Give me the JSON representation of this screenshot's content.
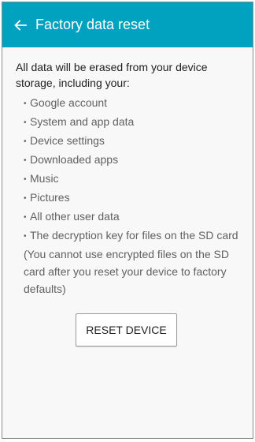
{
  "colors": {
    "app_bar": "#00a2c0",
    "background": "#f8f8f8"
  },
  "app_bar": {
    "back_icon": "arrow-left-icon",
    "title": "Factory data reset"
  },
  "content": {
    "intro": "All data will be erased from your device storage, including your:",
    "items": [
      "Google account",
      "System and app data",
      "Device settings",
      "Downloaded apps",
      "Music",
      "Pictures",
      "All other user data",
      "The decryption key for files on the SD card (You cannot use encrypted files on the SD card after you reset your device to factory defaults)"
    ],
    "bullet": "•",
    "reset_button_label": "RESET DEVICE"
  }
}
